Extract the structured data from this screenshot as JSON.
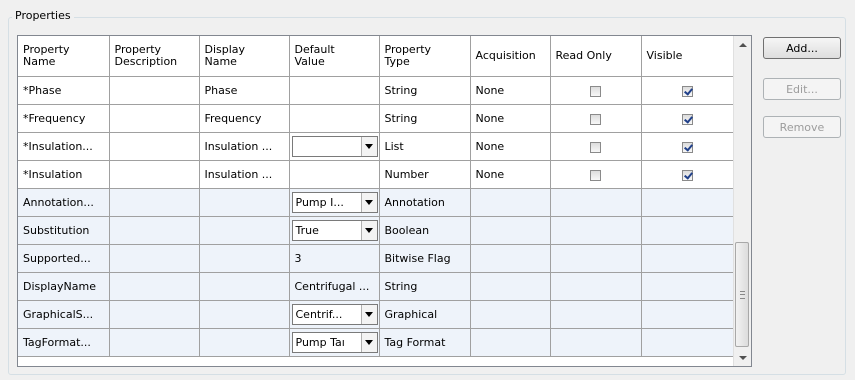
{
  "group": {
    "title": "Properties"
  },
  "columns": [
    "Property\nName",
    "Property\nDescription",
    "Display\nName",
    "Default\nValue",
    "Property\nType",
    "Acquisition",
    "Read Only",
    "Visible"
  ],
  "rows": [
    {
      "name": "*Phase",
      "description": "",
      "display": "Phase",
      "default": "",
      "default_is_combo": false,
      "type": "String",
      "acquisition": "None",
      "read_only": false,
      "visible": true,
      "checkboxes": true
    },
    {
      "name": "*Frequency",
      "description": "",
      "display": "Frequency",
      "default": "",
      "default_is_combo": false,
      "type": "String",
      "acquisition": "None",
      "read_only": false,
      "visible": true,
      "checkboxes": true
    },
    {
      "name": "*Insulation...",
      "description": "",
      "display": "Insulation ...",
      "default": "",
      "default_is_combo": true,
      "type": "List",
      "acquisition": "None",
      "read_only": false,
      "visible": true,
      "checkboxes": true
    },
    {
      "name": "*Insulation",
      "description": "",
      "display": "Insulation ...",
      "default": "",
      "default_is_combo": false,
      "type": "Number",
      "acquisition": "None",
      "read_only": false,
      "visible": true,
      "checkboxes": true
    },
    {
      "name": "Annotation...",
      "description": "",
      "display": "",
      "default": "Pump I...",
      "default_is_combo": true,
      "type": "Annotation",
      "acquisition": "",
      "checkboxes": false
    },
    {
      "name": "Substitution",
      "description": "",
      "display": "",
      "default": "True",
      "default_is_combo": true,
      "type": "Boolean",
      "acquisition": "",
      "checkboxes": false
    },
    {
      "name": "Supported...",
      "description": "",
      "display": "",
      "default": "3",
      "default_is_combo": false,
      "type": "Bitwise Flag",
      "acquisition": "",
      "checkboxes": false
    },
    {
      "name": "DisplayName",
      "description": "",
      "display": "",
      "default": "Centrifugal ...",
      "default_is_combo": false,
      "type": "String",
      "acquisition": "",
      "checkboxes": false
    },
    {
      "name": "GraphicalS...",
      "description": "",
      "display": "",
      "default": "Centrif...",
      "default_is_combo": true,
      "type": "Graphical",
      "acquisition": "",
      "checkboxes": false
    },
    {
      "name": "TagFormat...",
      "description": "",
      "display": "",
      "default": "Pump Taı",
      "default_is_combo": true,
      "type": "Tag Format",
      "acquisition": "",
      "checkboxes": false
    }
  ],
  "buttons": {
    "add": "Add...",
    "edit": "Edit...",
    "remove": "Remove"
  }
}
